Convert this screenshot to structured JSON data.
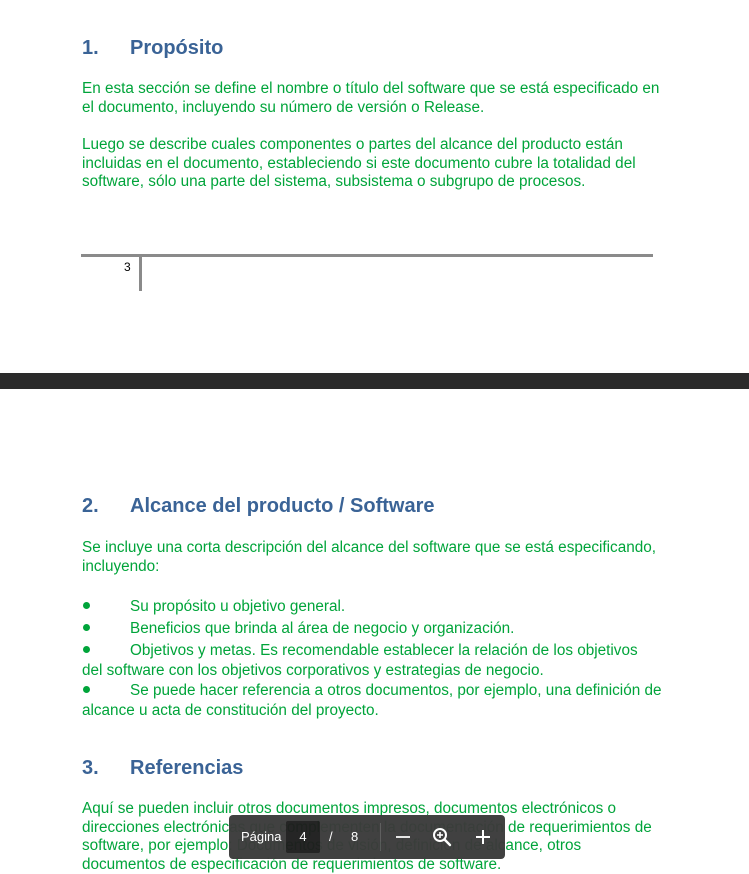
{
  "page1": {
    "section": {
      "number": "1.",
      "title": "Propósito"
    },
    "paragraphs": [
      "En esta sección se define el nombre o título del software que se está especificado en el documento, incluyendo su número de versión o Release.",
      "Luego se describe cuales componentes o partes del alcance del producto están incluidas en el documento, estableciendo si este documento cubre la totalidad del software, sólo una parte del sistema, subsistema o subgrupo de procesos."
    ],
    "footer_page_number": "3"
  },
  "page2": {
    "section2": {
      "number": "2.",
      "title": "Alcance del producto / Software",
      "intro": "Se incluye una corta descripción del alcance del software que se está especificando, incluyendo:",
      "bullets": [
        "Su propósito u objetivo general.",
        "Beneficios que brinda al área de negocio y organización.",
        "Objetivos y metas. Es recomendable establecer la relación de los objetivos del software con los objetivos corporativos y estrategias de negocio.",
        "Se puede hacer referencia a otros documentos, por ejemplo, una definición de alcance u acta de constitución del proyecto."
      ]
    },
    "section3": {
      "number": "3.",
      "title": "Referencias",
      "text": "Aquí se pueden incluir otros documentos impresos, documentos electrónicos o direcciones electrónicas que complementen la documentación de requerimientos de software, por ejemplo: Documentos de visión, definición de alcance, otros documentos de especificación de requerimientos de software."
    }
  },
  "toolbar": {
    "page_label": "Página",
    "current_page": "4",
    "separator": "/",
    "total_pages": "8",
    "icons": [
      "zoom-out-icon",
      "zoom-fit-icon",
      "zoom-in-icon"
    ]
  },
  "colors": {
    "heading": "#3a6396",
    "body_text": "#00a43a",
    "toolbar_bg": "#3b3b3b",
    "page_gap": "#2b2b2b"
  }
}
